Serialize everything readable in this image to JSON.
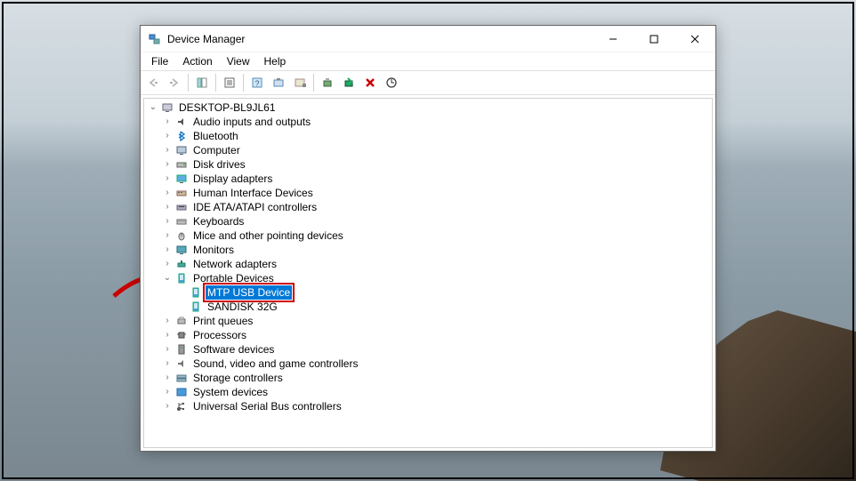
{
  "window": {
    "title": "Device Manager"
  },
  "menu": {
    "file": "File",
    "action": "Action",
    "view": "View",
    "help": "Help"
  },
  "tree": {
    "root": "DESKTOP-BL9JL61",
    "n_audio": "Audio inputs and outputs",
    "n_bluetooth": "Bluetooth",
    "n_computer": "Computer",
    "n_disk": "Disk drives",
    "n_display": "Display adapters",
    "n_hid": "Human Interface Devices",
    "n_ide": "IDE ATA/ATAPI controllers",
    "n_keyboards": "Keyboards",
    "n_mice": "Mice and other pointing devices",
    "n_monitors": "Monitors",
    "n_network": "Network adapters",
    "n_portable": "Portable Devices",
    "n_mtp": "MTP USB Device",
    "n_sandisk": "SANDISK 32G",
    "n_print": "Print queues",
    "n_processors": "Processors",
    "n_software": "Software devices",
    "n_sound": "Sound, video and game controllers",
    "n_storage": "Storage controllers",
    "n_system": "System devices",
    "n_usb": "Universal Serial Bus controllers"
  }
}
